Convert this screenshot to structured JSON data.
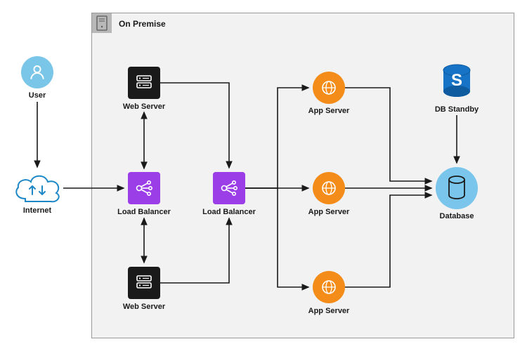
{
  "diagram": {
    "container": {
      "title": "On Premise"
    },
    "nodes": {
      "user": {
        "label": "User"
      },
      "internet": {
        "label": "Internet"
      },
      "lb1": {
        "label": "Load Balancer"
      },
      "lb2": {
        "label": "Load Balancer"
      },
      "ws1": {
        "label": "Web Server"
      },
      "ws2": {
        "label": "Web Server"
      },
      "app1": {
        "label": "App Server"
      },
      "app2": {
        "label": "App Server"
      },
      "app3": {
        "label": "App Server"
      },
      "db_standby": {
        "label": "DB Standby"
      },
      "database": {
        "label": "Database"
      }
    },
    "edges": [
      {
        "from": "user",
        "to": "internet",
        "bidir": false
      },
      {
        "from": "internet",
        "to": "lb1",
        "bidir": false
      },
      {
        "from": "lb1",
        "to": "ws1",
        "bidir": true
      },
      {
        "from": "lb1",
        "to": "ws2",
        "bidir": true
      },
      {
        "from": "ws1",
        "to": "lb2",
        "bidir": false
      },
      {
        "from": "ws2",
        "to": "lb2",
        "bidir": false
      },
      {
        "from": "lb2",
        "to": "app1",
        "bidir": false
      },
      {
        "from": "lb2",
        "to": "app2",
        "bidir": false
      },
      {
        "from": "lb2",
        "to": "app3",
        "bidir": false
      },
      {
        "from": "app1",
        "to": "database",
        "bidir": false
      },
      {
        "from": "app2",
        "to": "database",
        "bidir": false
      },
      {
        "from": "app3",
        "to": "database",
        "bidir": false
      },
      {
        "from": "db_standby",
        "to": "database",
        "bidir": false
      }
    ],
    "colors": {
      "load_balancer": "#9c3ee8",
      "web_server": "#1a1a1a",
      "app_server": "#f48c1a",
      "database": "#79c5ec",
      "db_standby_badge": "#1773c6",
      "cloud_outline": "#1e88c7"
    }
  }
}
